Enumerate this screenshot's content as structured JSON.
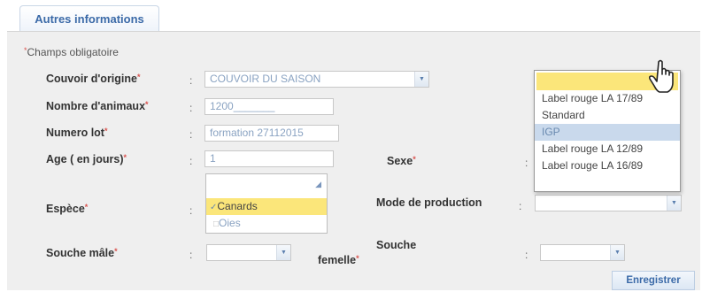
{
  "tab": {
    "label": "Autres informations"
  },
  "required_note": "Champs obligatoire",
  "fields": {
    "couvoir": {
      "label": "Couvoir d'origine",
      "value": "COUVOIR DU SAISON"
    },
    "nombre": {
      "label": "Nombre d'animaux",
      "value": "1200_______"
    },
    "lot": {
      "label": "Numero lot",
      "value": "formation 27112015"
    },
    "age": {
      "label": "Age ( en jours)",
      "value": "1"
    },
    "sexe": {
      "label": "Sexe"
    },
    "espece": {
      "label": "Espèce",
      "options": [
        "Canards",
        "Oies"
      ],
      "selected": "Canards"
    },
    "mode": {
      "label": "Mode de production",
      "options": [
        "",
        "Label rouge LA 17/89",
        "Standard",
        "IGP",
        "Label rouge LA 12/89",
        "Label rouge LA 16/89"
      ],
      "highlighted": "IGP"
    },
    "souche_male": {
      "label": "Souche mâle"
    },
    "souche_femelle": {
      "label_line1": "Souche",
      "label_line2": "femelle"
    }
  },
  "colon": ":",
  "required_mark": "*",
  "save_button": "Enregistrer",
  "colors": {
    "accent": "#3b6aa8",
    "required": "#d9534f",
    "highlight": "#fbe67a",
    "selection": "#c9d9ec"
  }
}
